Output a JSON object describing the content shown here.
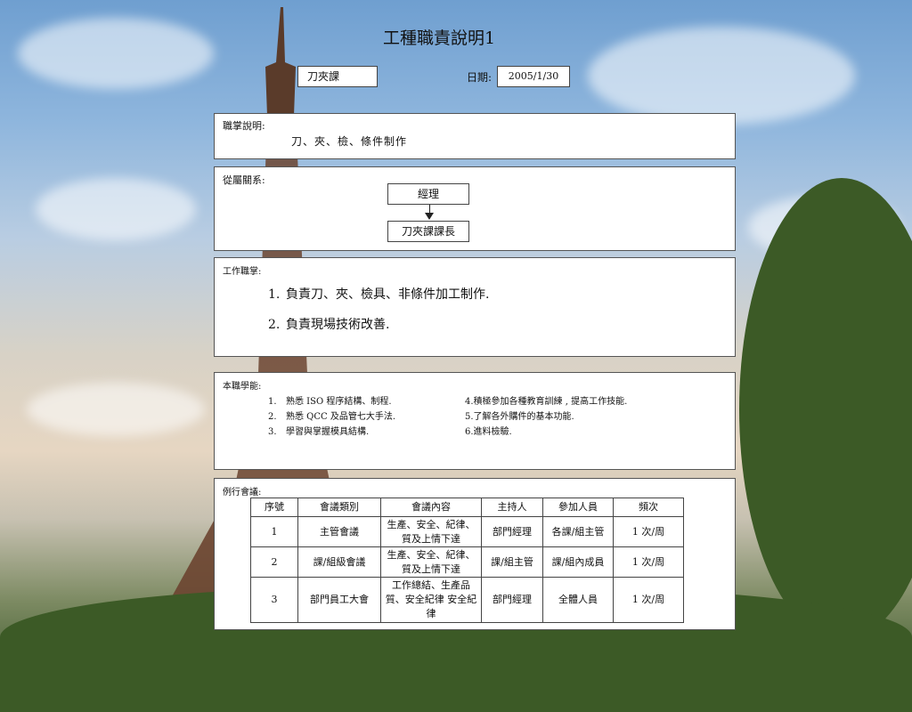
{
  "title": "工種職責說明1",
  "department": "刀夾課",
  "date_label": "日期:",
  "date_value": "2005/1/30",
  "duty": {
    "label": "職掌說明:",
    "text": "刀、夾、檢、條件制作"
  },
  "relation": {
    "label": "從屬關系:",
    "superior": "經理",
    "subordinate": "刀夾課課長"
  },
  "work": {
    "label": "工作職掌:",
    "items": [
      {
        "num": "1.",
        "text": "負責刀、夾、檢具、非條件加工制作."
      },
      {
        "num": "2.",
        "text": "負責現場技術改善."
      }
    ]
  },
  "skills": {
    "label": "本職學能:",
    "items": [
      {
        "num": "1.",
        "text": "熟悉 ISO 程序結構、制程."
      },
      {
        "num": "2.",
        "text": "熟悉 QCC 及品管七大手法."
      },
      {
        "num": "3.",
        "text": "學習與掌握模具結構."
      },
      {
        "num": "",
        "text": "4.積極參加各種教育訓練 , 提高工作技能."
      },
      {
        "num": "",
        "text": "5.了解各外購件的基本功能."
      },
      {
        "num": "",
        "text": "6.進料檢驗."
      }
    ]
  },
  "meetings": {
    "label": "例行會議:",
    "headers": [
      "序號",
      "會議類別",
      "會議內容",
      "主持人",
      "參加人員",
      "頻次"
    ],
    "rows": [
      [
        "1",
        "主管會議",
        "生產、安全、紀律、質及上情下達",
        "部門經理",
        "各課/組主管",
        "1 次/周"
      ],
      [
        "2",
        "課/組級會議",
        "生產、安全、紀律、質及上情下達",
        "課/組主管",
        "課/組內成員",
        "1 次/周"
      ],
      [
        "3",
        "部門員工大會",
        "工作總結、生產品質、安全紀律 安全紀律",
        "部門經理",
        "全體人員",
        "1 次/周"
      ]
    ]
  },
  "background_image": "eiffel-tower-sky-photo"
}
